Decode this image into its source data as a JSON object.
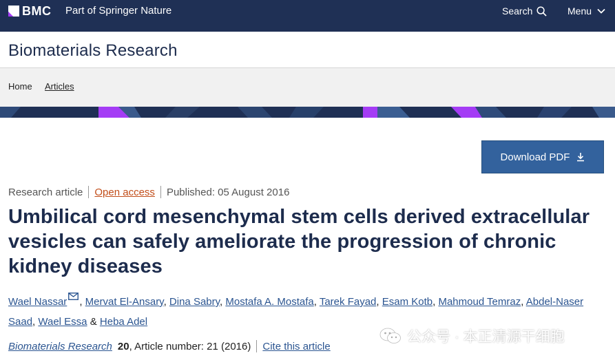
{
  "header": {
    "logo_text": "BMC",
    "tagline": "Part of Springer Nature",
    "search_label": "Search",
    "menu_label": "Menu"
  },
  "journal": {
    "title": "Biomaterials Research"
  },
  "breadcrumb": {
    "items": [
      "Home",
      "Articles"
    ]
  },
  "download": {
    "label": "Download PDF"
  },
  "article": {
    "type": "Research article",
    "access": "Open access",
    "published": "Published: 05 August 2016",
    "title": "Umbilical cord mesenchymal stem cells derived extracellular vesicles can safely ameliorate the progression of chronic kidney diseases",
    "authors": [
      "Wael Nassar",
      "Mervat El-Ansary",
      "Dina Sabry",
      "Mostafa A. Mostafa",
      "Tarek Fayad",
      "Esam Kotb",
      "Mahmoud Temraz",
      "Abdel-Naser Saad",
      "Wael Essa",
      "Heba Adel"
    ],
    "separators": {
      "comma": ",",
      "and": "&"
    },
    "citation": {
      "journal": "Biomaterials Research",
      "volume": "20",
      "rest": ", Article number: 21 (2016)",
      "cite_label": "Cite this article"
    }
  },
  "watermark": {
    "text": "公众号 · 本正清源干细胞"
  },
  "colors": {
    "header_bg": "#1f3055",
    "accent_purple": "#a43cf5",
    "title_navy": "#1d2c4d",
    "link_blue": "#2b5591",
    "open_access_orange": "#c24e1a",
    "button_blue": "#33629d"
  },
  "icons": {
    "search": "magnifier-icon",
    "menu": "chevron-down-icon",
    "download": "download-arrow-icon",
    "email": "envelope-icon",
    "watermark": "wechat-icon"
  }
}
